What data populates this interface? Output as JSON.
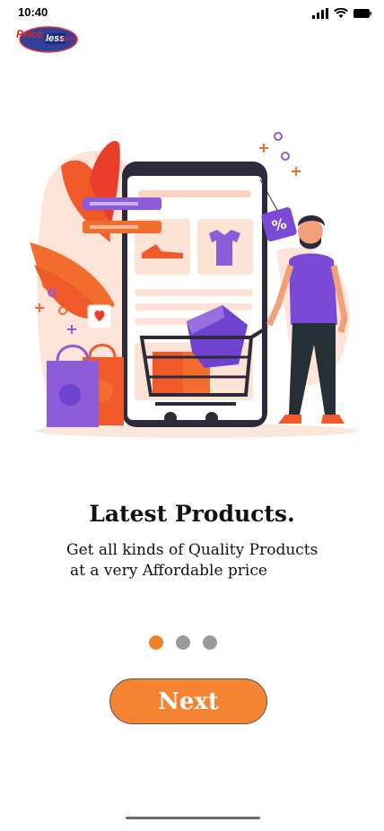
{
  "status_bar": {
    "time": "10:40"
  },
  "logo": {
    "word1": "Price",
    "word2": "less",
    "word3": "Stores"
  },
  "onboarding": {
    "title": "Latest Products.",
    "subtitle_line1": "Get all kinds of Quality Products",
    "subtitle_line2": "at a very Affordable price",
    "page_count": 3,
    "active_page": 1,
    "discount_tag": "%"
  },
  "actions": {
    "next_label": "Next"
  },
  "colors": {
    "accent": "#f48431",
    "purple": "#7a4ad6",
    "dot_inactive": "#9b9b9b"
  }
}
